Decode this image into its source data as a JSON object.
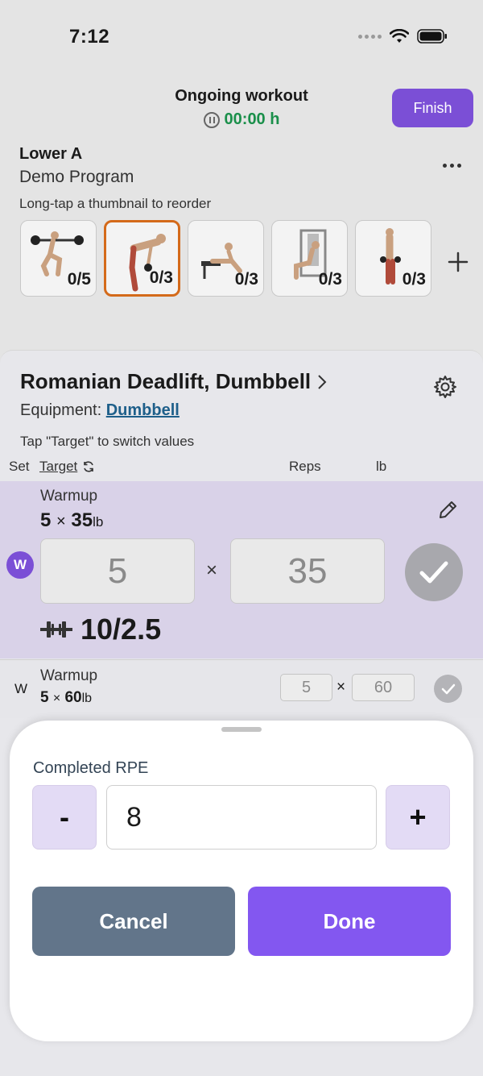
{
  "status_bar": {
    "time": "7:12"
  },
  "header": {
    "title": "Ongoing workout",
    "timer": "00:00 h",
    "finish_label": "Finish"
  },
  "program": {
    "workout_name": "Lower A",
    "program_name": "Demo Program",
    "hint": "Long-tap a thumbnail to reorder",
    "thumbnails": [
      {
        "progress": "0/5",
        "selected": false
      },
      {
        "progress": "0/3",
        "selected": true
      },
      {
        "progress": "0/3",
        "selected": false
      },
      {
        "progress": "0/3",
        "selected": false
      },
      {
        "progress": "0/3",
        "selected": false
      }
    ]
  },
  "exercise": {
    "title": "Romanian Deadlift, Dumbbell",
    "equipment_label": "Equipment:",
    "equipment_value": "Dumbbell",
    "tap_hint": "Tap \"Target\" to switch values",
    "columns": {
      "set": "Set",
      "target": "Target",
      "reps": "Reps",
      "weight": "lb"
    },
    "active_set": {
      "badge": "W",
      "label": "Warmup",
      "target_reps": "5",
      "target_times": "×",
      "target_weight": "35",
      "target_unit": "lb",
      "reps_value": "5",
      "times": "×",
      "weight_value": "35",
      "plates": "10/2.5"
    },
    "next_set": {
      "badge": "W",
      "label": "Warmup",
      "target_reps": "5",
      "target_times": "×",
      "target_weight": "60",
      "target_unit": "lb",
      "reps_value": "5",
      "times": "×",
      "weight_value": "60"
    }
  },
  "rpe_sheet": {
    "label": "Completed RPE",
    "minus_label": "-",
    "plus_label": "+",
    "value": "8",
    "cancel_label": "Cancel",
    "done_label": "Done"
  }
}
